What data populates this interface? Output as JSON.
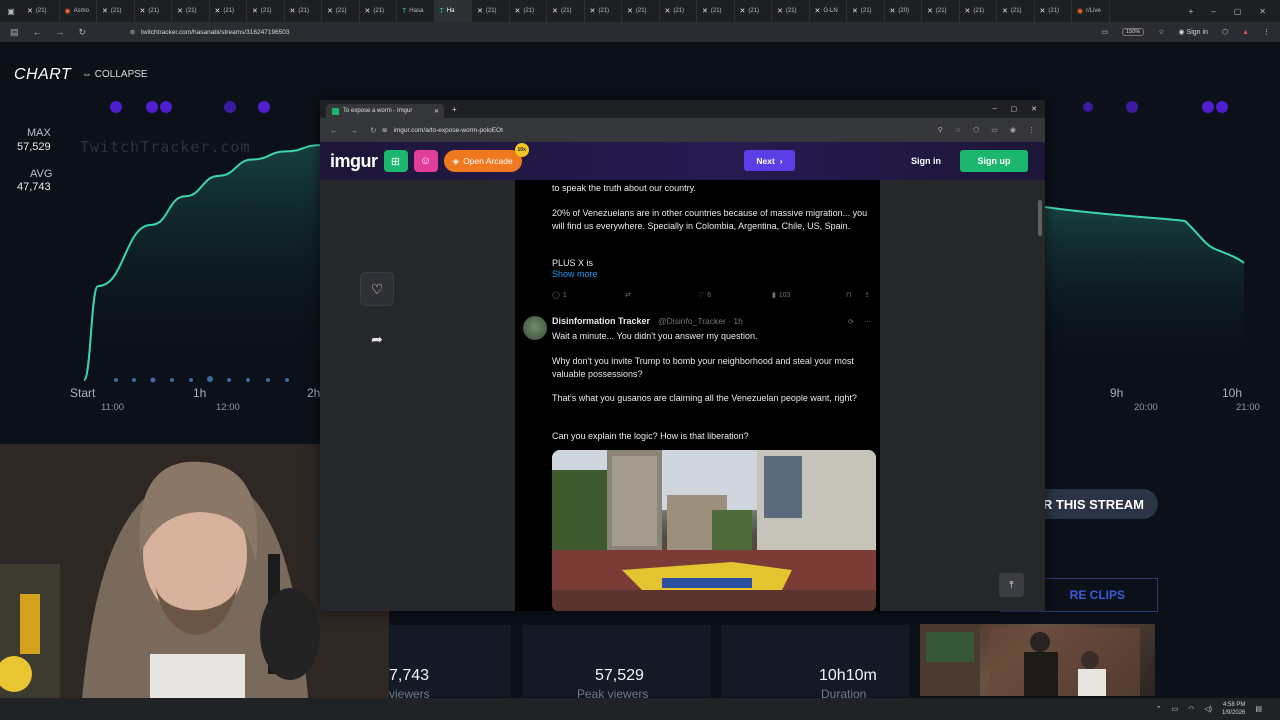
{
  "browser": {
    "tabs": [
      "(21)",
      "Asmo",
      "(21)",
      "(21)",
      "(21)",
      "(21)",
      "(21)",
      "(21)",
      "(21)",
      "(21)",
      "Hasa",
      "Ha",
      "(21)",
      "(21)",
      "(21)",
      "(21)",
      "(21)",
      "(21)",
      "(21)",
      "(21)",
      "(21)",
      "G-LN",
      "(21)",
      "(20)",
      "(21)",
      "(21)",
      "(21)",
      "(21)",
      "r/Live"
    ],
    "url": "twitchtracker.com/hasanabi/streams/316247196503",
    "zoom": "150%",
    "signin": "Sign in"
  },
  "tracker": {
    "chart_title": "CHART",
    "collapse": "COLLAPSE",
    "max_label": "MAX",
    "max_value": "57,529",
    "avg_label": "AVG",
    "avg_value": "47,743",
    "watermark": "TwitchTracker.com",
    "x_ticks": [
      "Start",
      "1h",
      "2h",
      "9h",
      "10h"
    ],
    "x_times": [
      "11:00",
      "12:00",
      "20:00",
      "21:00"
    ],
    "stream_button": "R THIS STREAM",
    "clips_button": "RE CLIPS",
    "stats": [
      {
        "value": "7,743",
        "label": "viewers"
      },
      {
        "value": "57,529",
        "label": "Peak viewers"
      },
      {
        "value": "10h10m",
        "label": "Duration"
      }
    ]
  },
  "chart_data": {
    "type": "area",
    "series": [
      {
        "values": [
          0,
          23000,
          38000,
          45000,
          50000,
          54000,
          56000,
          57529
        ]
      }
    ],
    "ylim": [
      0,
      60000
    ]
  },
  "imgur_window": {
    "tab_title": "To expose a worm - Imgur",
    "url": "imgur.com/a/to-expose-worm-poloEOt",
    "logo": "imgur",
    "arcade": "Open Arcade",
    "arcade_badge": "10x",
    "next": "Next",
    "signin": "Sign in",
    "signup": "Sign up"
  },
  "post": {
    "line0": "to speak the truth about our country.",
    "p1": "20% of Venezuelans are in other countries because of massive migration... you will find us everywhere. Specially in Colombia, Argentina, Chile, US, Spain.",
    "p2": "PLUS X is",
    "show_more": "Show more",
    "actions": {
      "replies": "1",
      "likes": "6",
      "views": "103"
    },
    "reply": {
      "name": "Disinformation Tracker",
      "handle": "@Disinfo_Tracker · 1h",
      "l1": "Wait a minute... You didn't you answer my question.",
      "l2": "Why don't you invite Trump to bomb your neighborhood and steal your most valuable possessions?",
      "l3": "That's what you gusanos are claiming all the Venezuelan people want, right?",
      "l4": "Can you explain the logic? How is that liberation?"
    }
  },
  "taskbar": {
    "time": "4:58 PM",
    "date": "1/9/2026"
  }
}
